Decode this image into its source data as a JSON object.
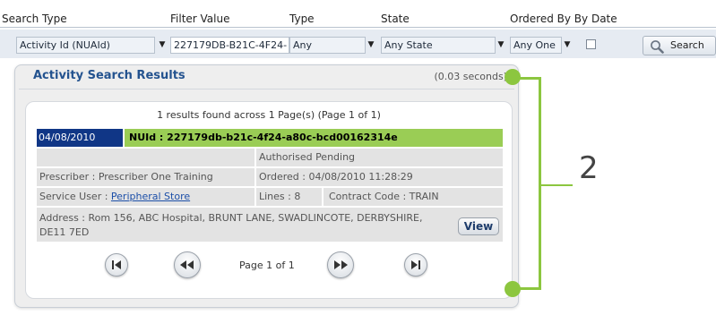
{
  "search": {
    "headers": [
      "Search Type",
      "Filter Value",
      "Type",
      "State",
      "Ordered By By Date"
    ],
    "search_type": "Activity Id (NUAId)",
    "filter_value": "227179DB-B21C-4F24-",
    "type": "Any",
    "state": "Any State",
    "ordered_by": "Any One",
    "search_button": "Search"
  },
  "results": {
    "title": "Activity Search Results",
    "elapsed": "(0.03 seconds)",
    "summary": "1 results found across 1 Page(s) (Page 1 of 1)",
    "record": {
      "date": "04/08/2010",
      "nuid": "NUId : 227179db-b21c-4f24-a80c-bcd00162314e",
      "status": "Authorised Pending",
      "prescriber": "Prescriber : Prescriber One Training",
      "ordered": "Ordered : 04/08/2010 11:28:29",
      "service_user_label": "Service User : ",
      "service_user_link": "Peripheral Store",
      "lines": "Lines : 8",
      "contract_code": "Contract Code : TRAIN",
      "address": "Address : Rom 156, ABC Hospital, BRUNT LANE, SWADLINCOTE, DERBYSHIRE, DE11 7ED",
      "view_button": "View"
    },
    "pagination": {
      "text": "Page 1 of 1"
    }
  },
  "callout": {
    "number": "2",
    "color": "#8cc63f"
  },
  "colors": {
    "title_blue": "#24538f",
    "date_bg": "#103686",
    "nuid_bg": "#9acd55",
    "link": "#1c4fa8"
  }
}
